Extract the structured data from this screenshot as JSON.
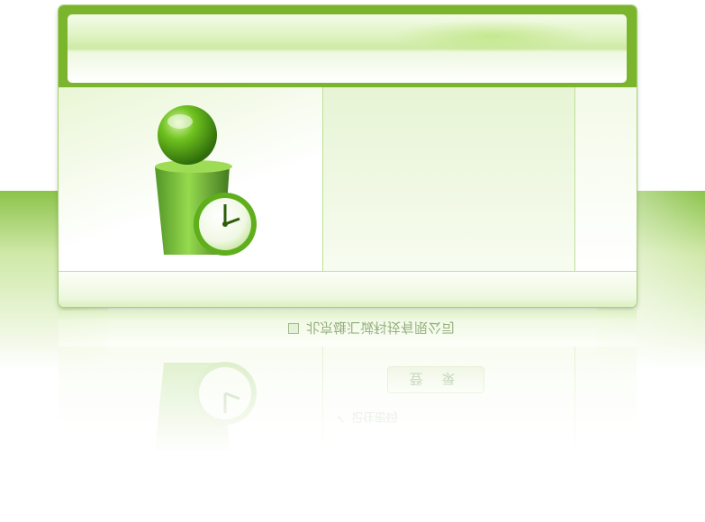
{
  "login": {
    "company_name": "北京雄汇诚科技有限公司",
    "login_button": "登 录",
    "remember_password": "记住密码"
  },
  "colors": {
    "accent_green": "#7bb52e",
    "light_green": "#e0f3c4",
    "border_green": "#bfe09a"
  },
  "icons": {
    "logo": "green-person-clock-logo"
  }
}
